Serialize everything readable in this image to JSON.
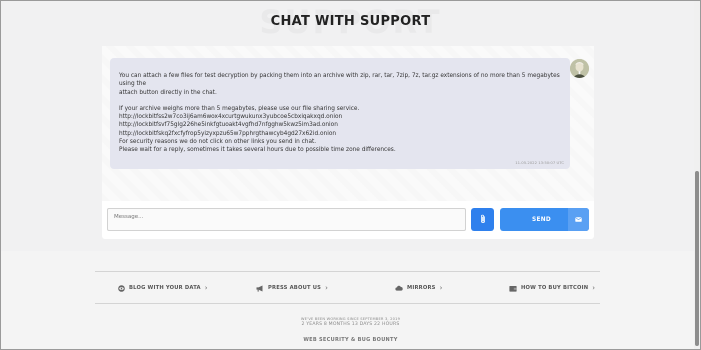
{
  "page": {
    "watermark": "SUPPORT",
    "title": "CHAT WITH SUPPORT"
  },
  "chat": {
    "message_lines": [
      "You can attach a few files for test decryption by packing them into an archive with zip, rar, tar, 7zip, 7z, tar.gz extensions of no more than 5 megabytes using the",
      "attach button directly in the chat.",
      "",
      "If your archive weighs more than 5 megabytes, please use our file sharing service.",
      "http://lockbitfss2w7co3ij6am6wox4xcurtgwukunx3yubcoe5cbxiqakxqd.onion",
      "http://lockbitfsvf75glg226he5inkfgtuoakt4vgfhd7nfgghw5kwz5im3ad.onion",
      "http://lockbitfskq2fxcfyfrop5yizyxpzu65w7pphrgthawcyb4gd27x62id.onion",
      "For security reasons we do not click on other links you send in chat.",
      "Please wait for a reply, sometimes it takes several hours due to possible time zone differences."
    ],
    "timestamp": "11.05.2022 13:50:07 UTC",
    "input_placeholder": "Message...",
    "send_label": "SEND"
  },
  "footer": {
    "links": [
      {
        "label": "BLOG WITH YOUR DATA",
        "icon": "eye-icon"
      },
      {
        "label": "PRESS ABOUT US",
        "icon": "megaphone-icon"
      },
      {
        "label": "MIRRORS",
        "icon": "cloud-icon"
      },
      {
        "label": "HOW TO BUY BITCOIN",
        "icon": "wallet-icon"
      }
    ],
    "since_text": "WE'VE BEEN WORKING SINCE SEPTEMBER 3, 2019",
    "uptime_text": "2 YEARS 8 MONTHS 13 DAYS 22 HOURS",
    "bounty_text": "WEB SECURITY & BUG BOUNTY"
  },
  "colors": {
    "accent": "#3b8ff0",
    "message_bg": "#e4e5ef",
    "page_bg": "#f1f1f2"
  }
}
